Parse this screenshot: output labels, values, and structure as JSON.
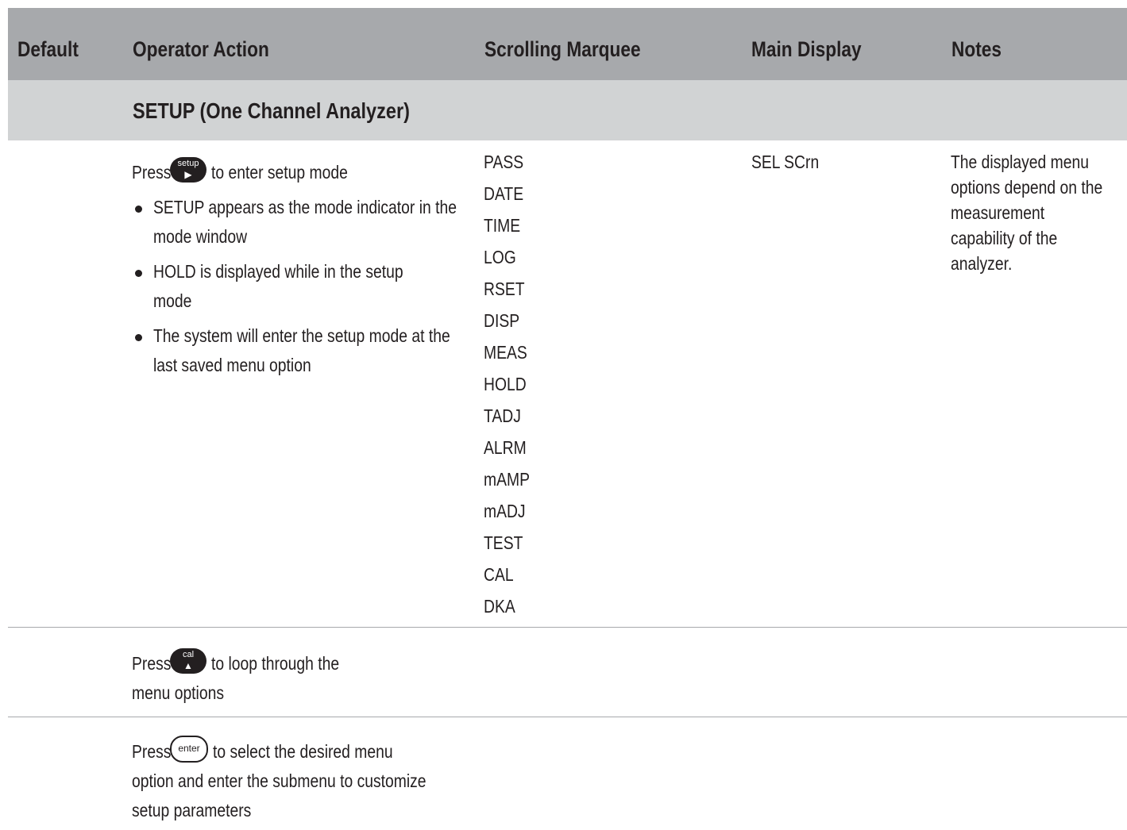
{
  "table": {
    "headers": {
      "default": "Default",
      "operator_action": "Operator Action",
      "scrolling_marquee": "Scrolling Marquee",
      "main_display": "Main Display",
      "notes": "Notes"
    },
    "section_title": "SETUP (One Channel Analyzer)",
    "rows": [
      {
        "action_prefix": "Press",
        "key_label": "setup",
        "key_icon": "play-triangle-icon",
        "action_suffix": "to enter setup mode",
        "bullets": [
          "SETUP appears as the mode indicator in the mode window",
          "HOLD is displayed while in the setup mode",
          "The system will enter the setup mode at the last saved menu option"
        ],
        "marquee": [
          "PASS",
          "DATE",
          "TIME",
          "LOG",
          "RSET",
          "DISP",
          "MEAS",
          "HOLD",
          "TADJ",
          "ALRM",
          "mAMP",
          "mADJ",
          "TEST",
          "CAL",
          "DKA"
        ],
        "main_display": "SEL SCrn",
        "notes": "The displayed menu options depend on the measurement capability of the analyzer."
      },
      {
        "action_prefix": "Press",
        "key_label": "cal",
        "key_icon": "up-triangle-icon",
        "action_suffix": "to loop through the",
        "action_line2": "menu options"
      },
      {
        "action_prefix": "Press",
        "key_label": "enter",
        "action_suffix": "to select the desired menu",
        "action_line2": "option and enter the submenu to customize",
        "action_line3": "setup parameters"
      }
    ]
  },
  "colors": {
    "header_bg": "#a7a9ac",
    "section_bg": "#d1d3d4",
    "text": "#231f20",
    "rule": "#a7a9ac"
  }
}
